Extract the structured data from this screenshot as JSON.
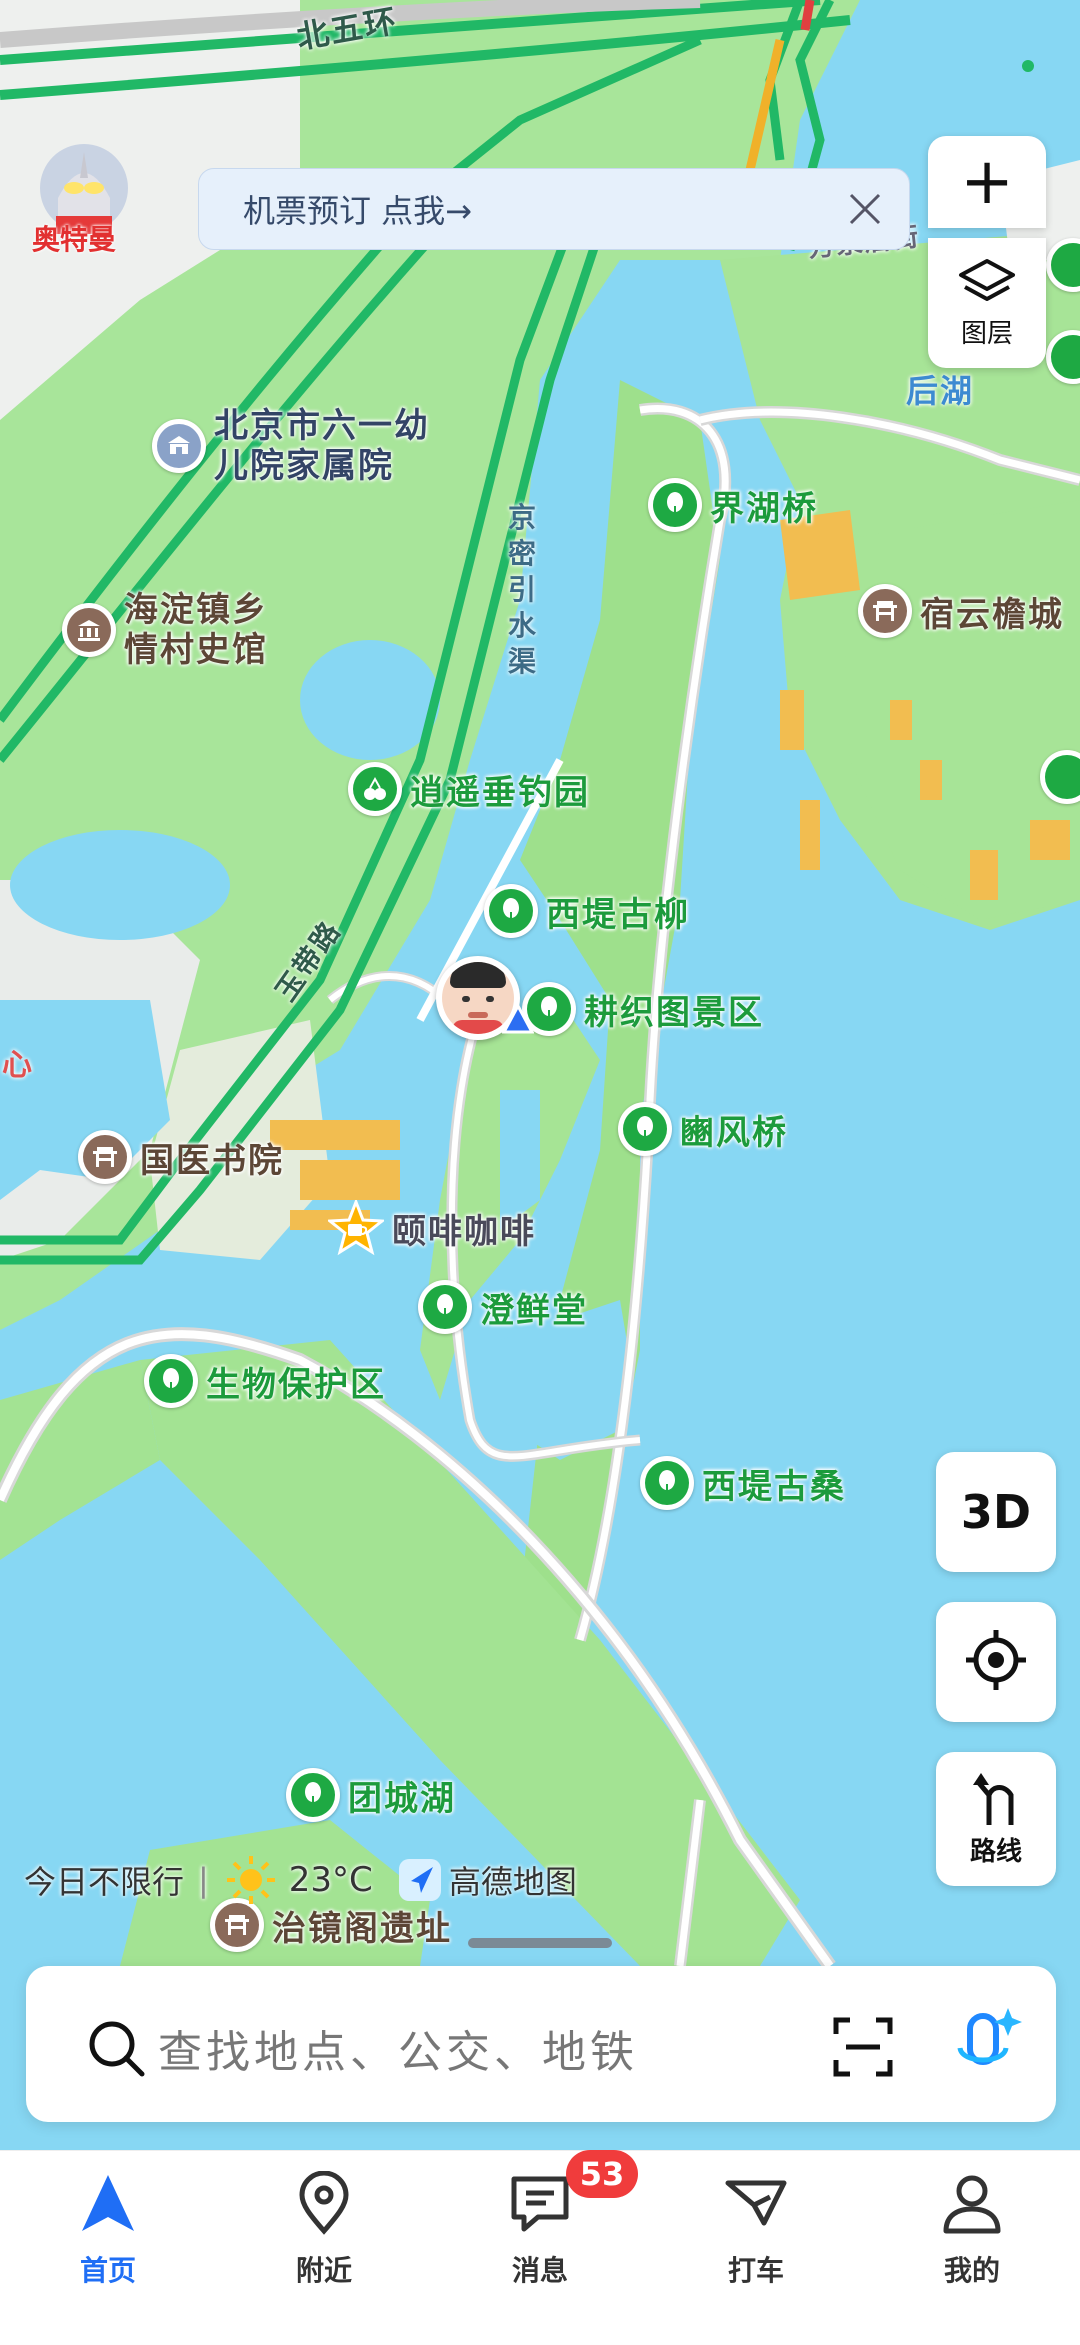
{
  "banner": {
    "text": "机票预订 点我→"
  },
  "map_controls": {
    "zoom_in": "+",
    "layers_label": "图层",
    "three_d": "3D",
    "route_label": "路线"
  },
  "road_labels": {
    "north_fifth_ring": "北五环",
    "jingmi_canal": "京密引水渠",
    "yudai_road": "玉带路",
    "houhu": "后湖",
    "wanquan_edge": "万泉后街",
    "xin_edge": "心"
  },
  "pois": {
    "kindergarten": "北京市六一幼儿院家属院",
    "village_museum": "海淀镇乡情村史馆",
    "jiehu_bridge": "界湖桥",
    "suyun": "宿云檐城",
    "fishing_park": "逍遥垂钓园",
    "xidi_willow": "西堤古柳",
    "gengzhi": "耕织图景区",
    "binfeng_bridge": "豳风桥",
    "medical_academy": "国医书院",
    "coffee": "颐啡咖啡",
    "chengxian_hall": "澄鲜堂",
    "bio_reserve": "生物保护区",
    "xidi_mulberry": "西堤古桑",
    "tuancheng_lake": "团城湖",
    "zhijing_ruins": "治镜阁遗址"
  },
  "brand": {
    "ultraman": "奥特曼",
    "amap": "高德地图"
  },
  "status": {
    "traffic": "今日不限行",
    "temperature": "23°C"
  },
  "search": {
    "placeholder": "查找地点、公交、地铁"
  },
  "tabs": [
    {
      "label": "首页",
      "icon": "navigation-arrow-icon",
      "active": true
    },
    {
      "label": "附近",
      "icon": "location-pin-icon",
      "active": false
    },
    {
      "label": "消息",
      "icon": "message-icon",
      "active": false
    },
    {
      "label": "打车",
      "icon": "taxi-icon",
      "active": false
    },
    {
      "label": "我的",
      "icon": "user-icon",
      "active": false
    }
  ],
  "message_badge": "53",
  "colors": {
    "water": "#87d7f3",
    "park": "#9de08e",
    "road_green": "#22b86b",
    "accent": "#1f6ef5",
    "badge": "#f03c3c"
  }
}
